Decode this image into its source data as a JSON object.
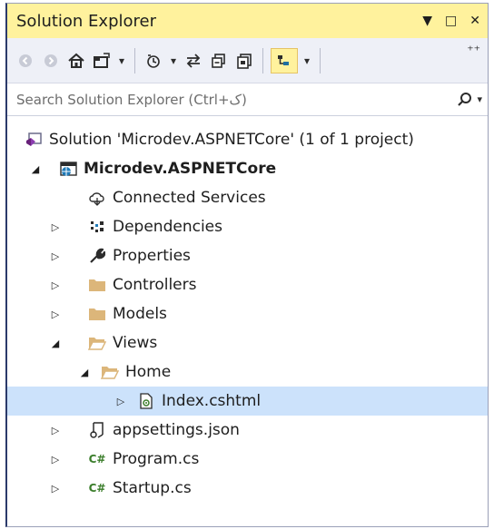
{
  "window": {
    "title": "Solution Explorer",
    "controls": {
      "dropdown": "▼",
      "maximize": "□",
      "close": "✕"
    }
  },
  "toolbar": {
    "buttons": [
      "back-icon",
      "forward-icon",
      "home-icon",
      "switch-views-icon",
      "pending-changes-filter-icon",
      "sync-icon",
      "collapse-all-icon",
      "show-all-files-icon",
      "preview-selected-icon"
    ],
    "overflow": "⁺⁺"
  },
  "search": {
    "placeholder": "Search Solution Explorer (Ctrl+ک)",
    "icon": "⚲"
  },
  "tree": {
    "solution": "Solution 'Microdev.ASPNETCore' (1 of 1 project)",
    "project": "Microdev.ASPNETCore",
    "connected_services": "Connected Services",
    "dependencies": "Dependencies",
    "properties": "Properties",
    "controllers": "Controllers",
    "models": "Models",
    "views": "Views",
    "home": "Home",
    "index": "Index.cshtml",
    "appsettings": "appsettings.json",
    "program": "Program.cs",
    "startup": "Startup.cs",
    "csharp_badge": "C#"
  },
  "colors": {
    "title_bg": "#fff29d",
    "selection_bg": "#cce2fb",
    "folder": "#dcb67a",
    "accent": "#2b3a6a"
  }
}
